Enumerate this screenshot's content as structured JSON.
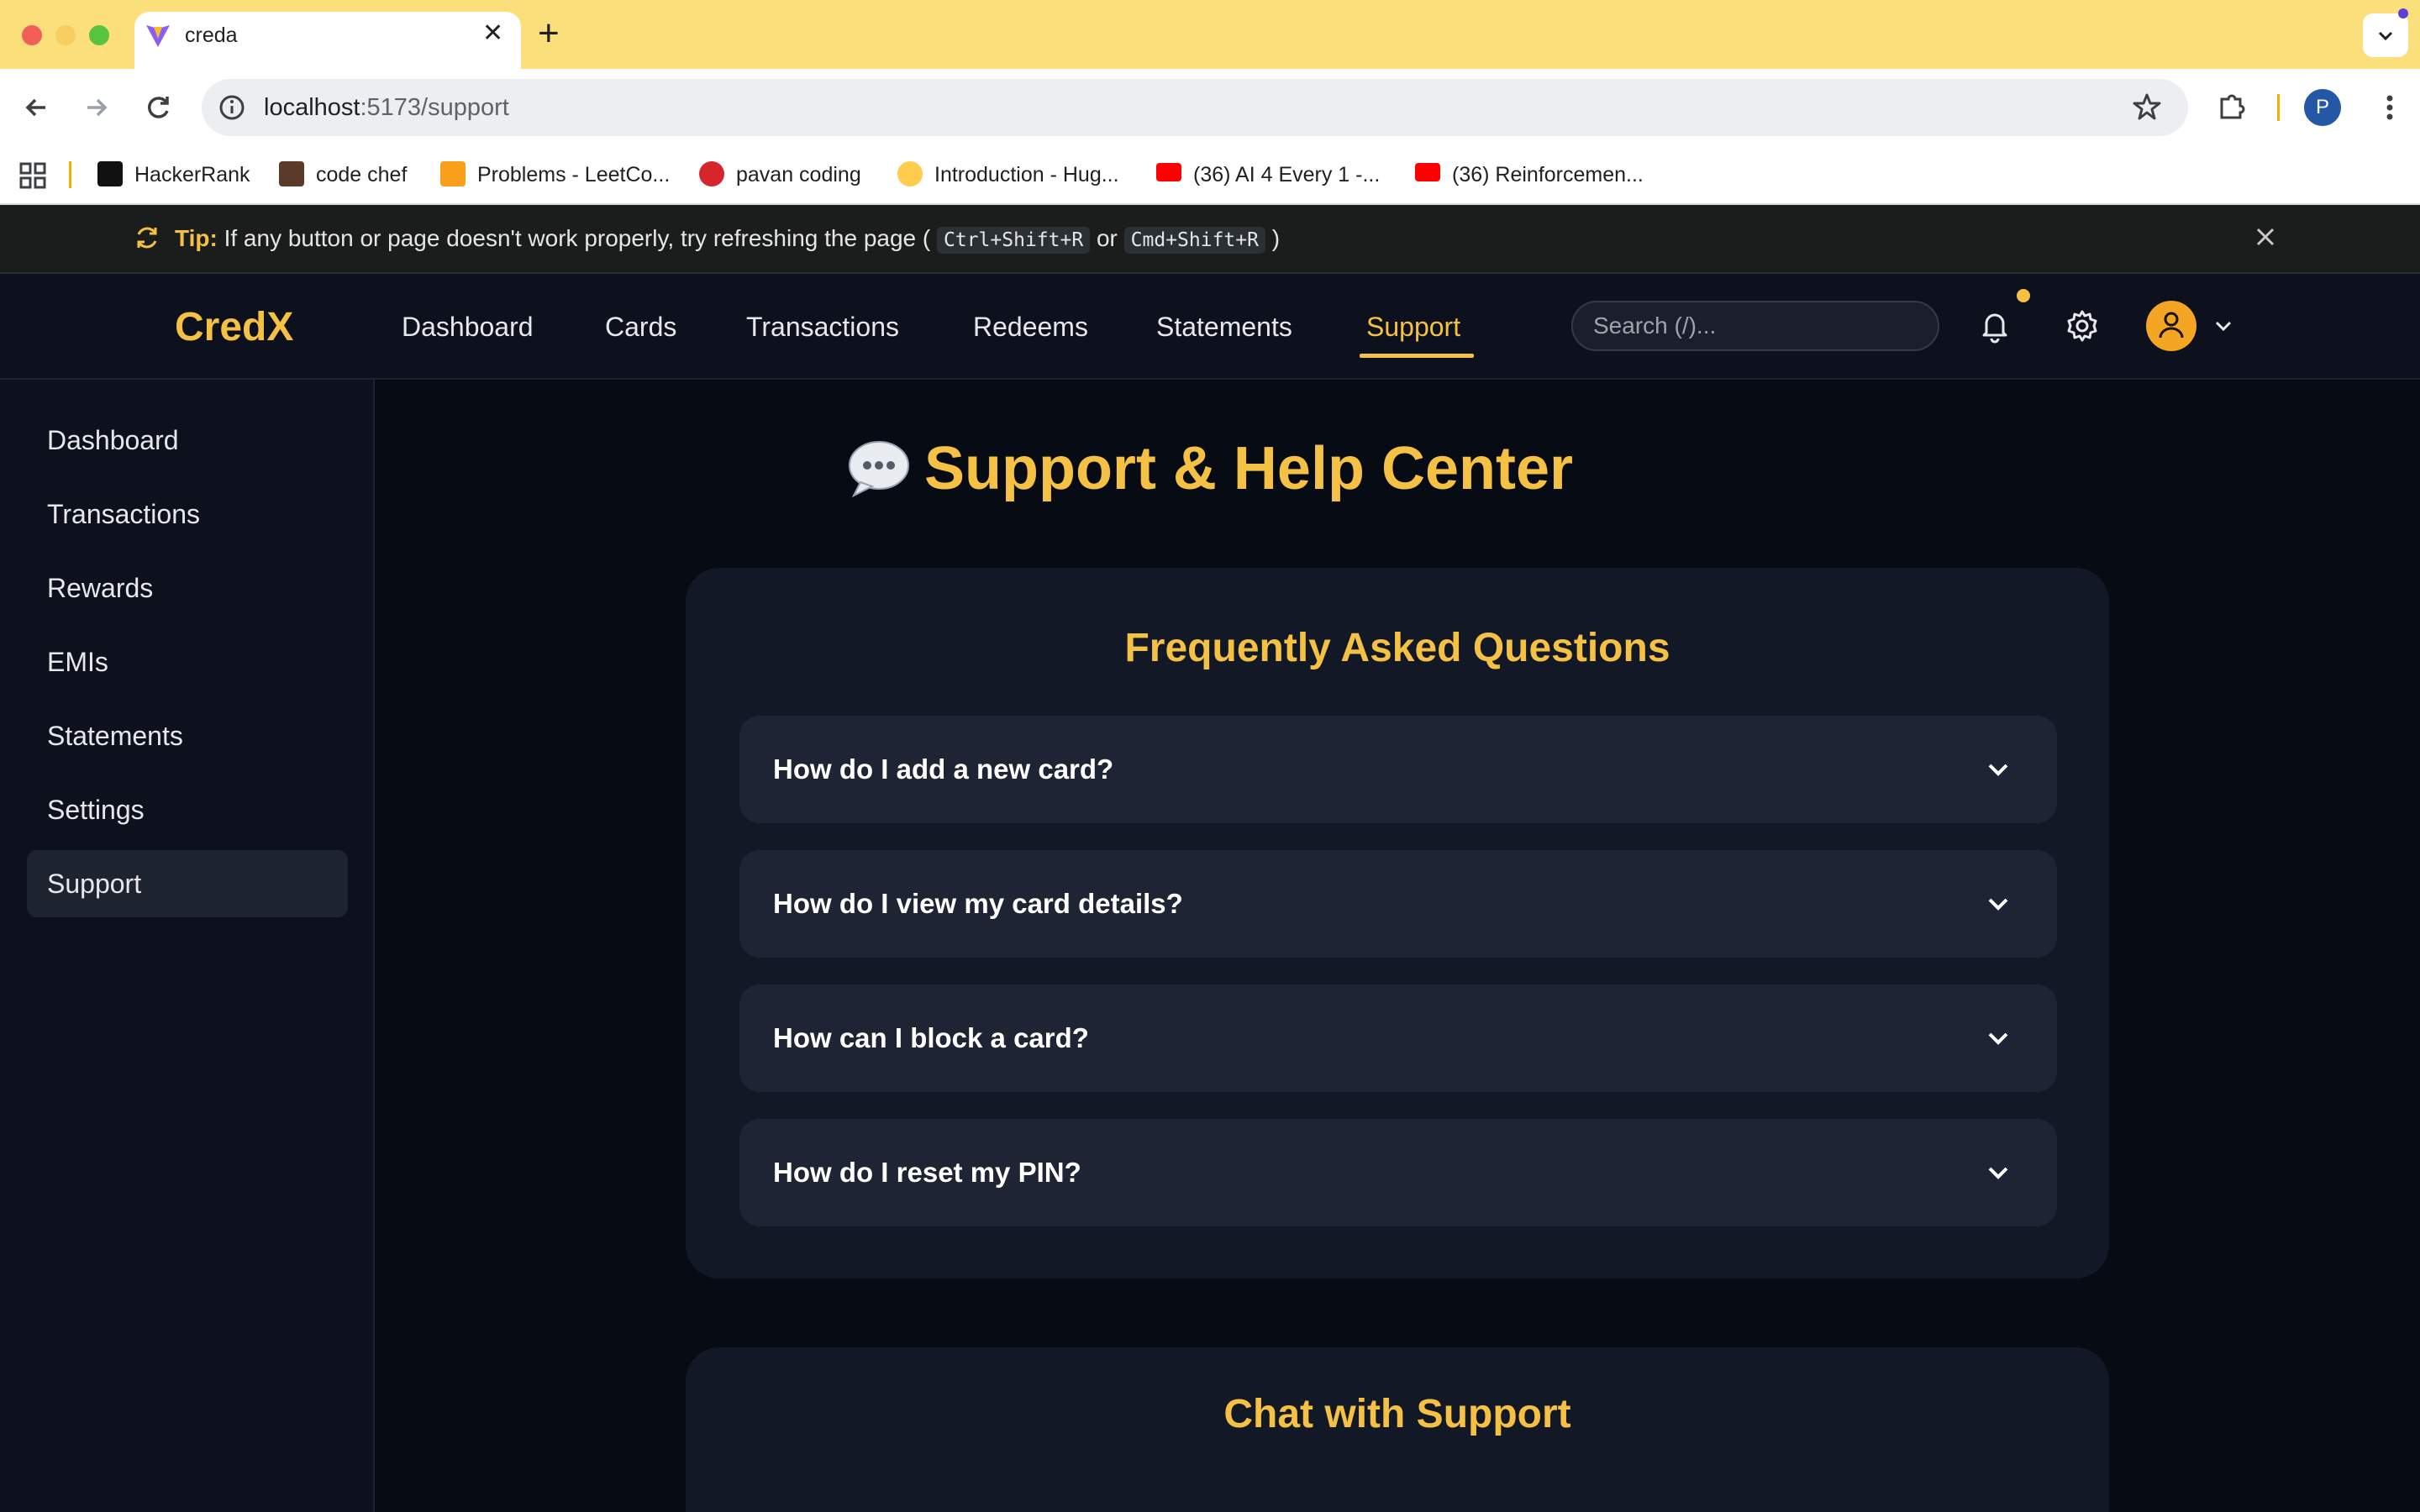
{
  "browser": {
    "tab_title": "creda",
    "url_host": "localhost",
    "url_path": ":5173/support",
    "profile_initial": "P",
    "bookmarks": [
      {
        "label": "HackerRank",
        "color": "#111111"
      },
      {
        "label": "code chef",
        "color": "#5b3a29"
      },
      {
        "label": "Problems - LeetCo...",
        "color": "#f89f1b"
      },
      {
        "label": "pavan coding",
        "color": "#d7262b"
      },
      {
        "label": "Introduction - Hug...",
        "color": "#ffcc4d"
      },
      {
        "label": "(36) AI 4 Every 1 -...",
        "color": "#ff0000"
      },
      {
        "label": "(36) Reinforcemen...",
        "color": "#ff0000"
      }
    ]
  },
  "tip": {
    "label": "Tip:",
    "text": "If any button or page doesn't work properly, try refreshing the page (",
    "key1": "Ctrl+Shift+R",
    "or": "or",
    "key2": "Cmd+Shift+R",
    "close_paren": ")"
  },
  "header": {
    "brand": "CredX",
    "nav": [
      "Dashboard",
      "Cards",
      "Transactions",
      "Redeems",
      "Statements",
      "Support"
    ],
    "active_nav": "Support",
    "search_placeholder": "Search (/)..."
  },
  "sidebar": {
    "items": [
      "Dashboard",
      "Transactions",
      "Rewards",
      "EMIs",
      "Statements",
      "Settings",
      "Support"
    ],
    "active": "Support"
  },
  "page": {
    "title": "Support & Help Center",
    "faq_title": "Frequently Asked Questions",
    "faqs": [
      "How do I add a new card?",
      "How do I view my card details?",
      "How can I block a card?",
      "How do I reset my PIN?"
    ],
    "chat_title": "Chat with Support"
  },
  "colors": {
    "accent": "#f5c144",
    "background": "#070b14",
    "card": "#121826",
    "faq_item": "#1e2433"
  }
}
